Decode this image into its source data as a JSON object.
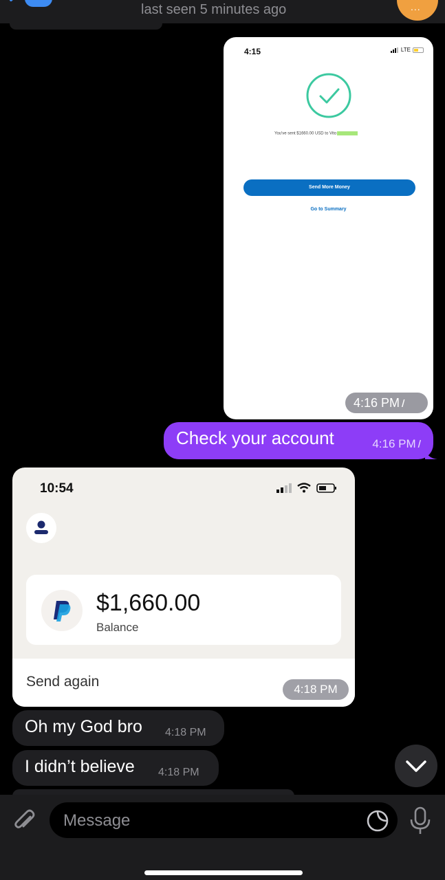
{
  "header": {
    "last_seen": "last seen 5 minutes ago",
    "avatar_initials": "..."
  },
  "messages": {
    "outgoing_image": {
      "phone_time": "4:15",
      "network": "LTE",
      "sent_text": "You've sent $1660.00 USD to Vito",
      "send_more_label": "Send More Money",
      "summary_label": "Go to Summary",
      "time": "4:16 PM",
      "ticks": "//"
    },
    "outgoing_text": {
      "text": "Check your account",
      "time": "4:16 PM",
      "ticks": "//"
    },
    "incoming_image": {
      "phone_time": "10:54",
      "amount": "$1,660.00",
      "balance_label": "Balance",
      "send_again_label": "Send again",
      "time": "4:18 PM"
    },
    "incoming_1": {
      "text": "Oh my God bro",
      "time": "4:18 PM"
    },
    "incoming_2": {
      "text": "I didn’t believe",
      "time": "4:18 PM"
    }
  },
  "input": {
    "placeholder": "Message"
  },
  "colors": {
    "outgoing_bubble": "#8d3df7",
    "incoming_bubble": "#1f1f22",
    "paypal_blue": "#0a6fc2",
    "check_green": "#3cc9a0"
  }
}
